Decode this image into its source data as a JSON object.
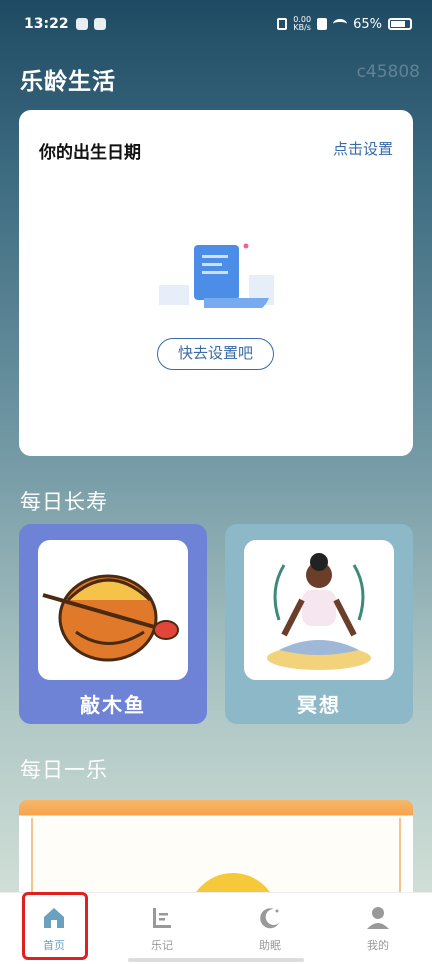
{
  "status": {
    "time": "13:22",
    "net_speed_value": "0.00",
    "net_speed_unit": "KB/s",
    "battery": "65%"
  },
  "header": {
    "title": "乐龄生活",
    "user_id": "c45808"
  },
  "birth_card": {
    "title": "你的出生日期",
    "action": "点击设置",
    "button": "快去设置吧"
  },
  "longevity": {
    "title": "每日长寿",
    "cards": [
      {
        "label": "敲木鱼",
        "icon": "wooden-fish-icon",
        "bg": "#6f83d6"
      },
      {
        "label": "冥想",
        "icon": "meditation-icon",
        "bg": "#8db8c8"
      }
    ]
  },
  "joy": {
    "title": "每日一乐"
  },
  "tabs": [
    {
      "label": "首页",
      "icon": "home-icon",
      "active": true
    },
    {
      "label": "乐记",
      "icon": "chart-icon",
      "active": false
    },
    {
      "label": "助眠",
      "icon": "moon-icon",
      "active": false
    },
    {
      "label": "我的",
      "icon": "person-icon",
      "active": false
    }
  ],
  "colors": {
    "accent": "#3a6aa8",
    "tab_active": "#6aa1bf",
    "highlight": "#e0201f"
  }
}
